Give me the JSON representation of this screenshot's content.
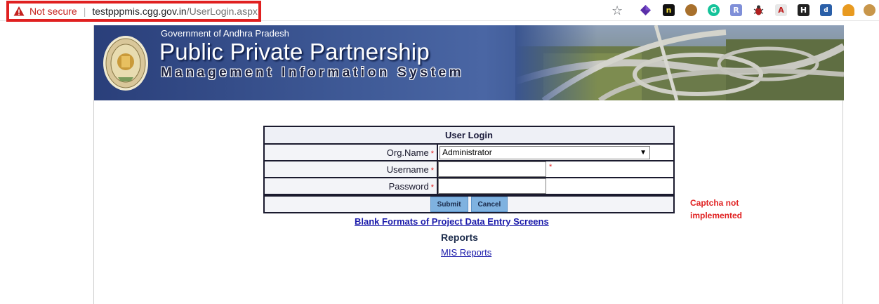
{
  "browser": {
    "security_text": "Not secure",
    "separator": "|",
    "url_host": "testpppmis.cgg.gov.in",
    "url_path": "/UserLogin.aspx",
    "bookmark_icon": "star-icon",
    "extension_icons": [
      "purple-diamond-icon",
      "n-extension-icon",
      "cookie-icon",
      "grammarly-icon",
      "r-extension-icon",
      "bug-icon",
      "pdf-icon",
      "h-extension-icon",
      "db-extension-icon",
      "basket-icon",
      "cookie-icon"
    ]
  },
  "banner": {
    "gov_text": "Government of Andhra Pradesh",
    "title": "Public Private Partnership",
    "subtitle": "Management Information System"
  },
  "login": {
    "header": "User Login",
    "org_label": "Org.Name",
    "org_value": "Administrator",
    "username_label": "Username",
    "username_value": "",
    "password_label": "Password",
    "password_value": "",
    "required_mark": "*",
    "submit_label": "Submit",
    "cancel_label": "Cancel"
  },
  "captcha_note": "Captcha not implemented",
  "links": {
    "blank_formats": "Blank Formats of Project Data Entry Screens",
    "reports_heading": "Reports",
    "mis_reports": "MIS Reports"
  },
  "colors": {
    "required": "#e02020",
    "link": "#1a1aaa",
    "button": "#7fb2e0",
    "banner": "#3f5a97"
  },
  "chart_data": {}
}
